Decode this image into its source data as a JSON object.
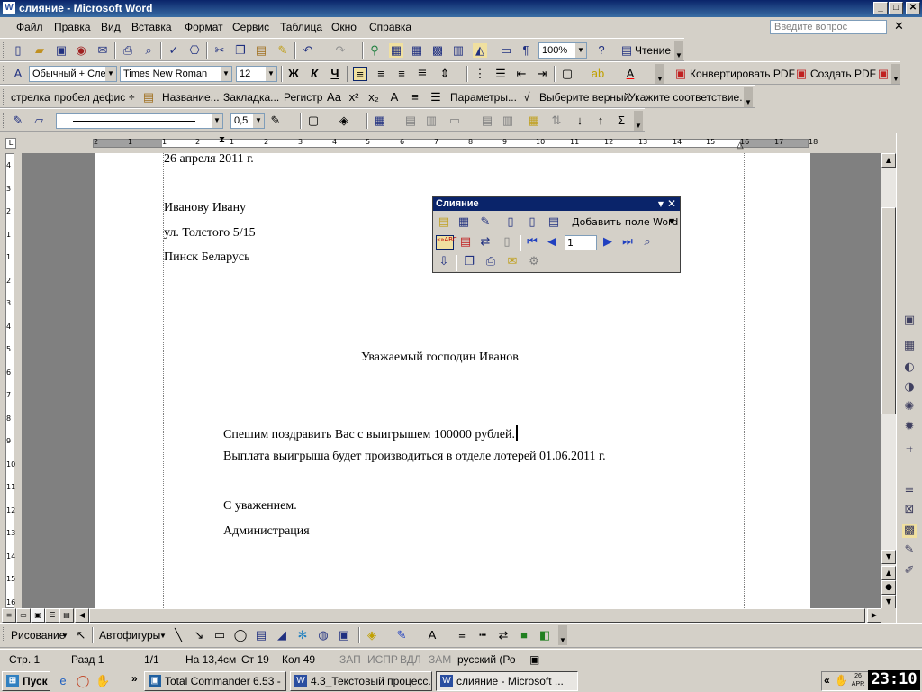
{
  "window": {
    "title": "слияние - Microsoft Word",
    "min": "_",
    "max": "□",
    "close": "✕"
  },
  "menu": {
    "items": [
      "Файл",
      "Правка",
      "Вид",
      "Вставка",
      "Формат",
      "Сервис",
      "Таблица",
      "Окно",
      "Справка"
    ],
    "ask_placeholder": "Введите вопрос",
    "close": "✕"
  },
  "standard_toolbar": {
    "zoom": "100%",
    "read_label": "Чтение",
    "para_mark": "¶"
  },
  "format_toolbar": {
    "style": "Обычный + Сле",
    "font": "Times New Roman",
    "size": "12",
    "bold": "Ж",
    "italic": "К",
    "underline": "Ч",
    "convert_pdf": "Конвертировать PDF",
    "create_pdf": "Создать PDF"
  },
  "macro_toolbar": {
    "items": [
      "стрелка",
      "пробел",
      "дефис",
      "÷",
      "Название...",
      "Закладка...",
      "Регистр"
    ],
    "params": "Параметры...",
    "choose": "Выберите верный",
    "match": "Укажите соответствие."
  },
  "tables_toolbar": {
    "line_weight": "0,5",
    "sigma": "Σ"
  },
  "ruler": {
    "labels": [
      "2",
      "1",
      "1",
      "2",
      "1",
      "2",
      "3",
      "4",
      "5",
      "6",
      "7",
      "8",
      "9",
      "10",
      "11",
      "12",
      "13",
      "14",
      "15",
      "16",
      "17",
      "18"
    ]
  },
  "left_ruler": {
    "labels": [
      "4",
      "3",
      "2",
      "1",
      "1",
      "2",
      "3",
      "4",
      "5",
      "6",
      "7",
      "8",
      "9",
      "10",
      "11",
      "12",
      "13",
      "14",
      "15",
      "16"
    ]
  },
  "document": {
    "date": "26 апреля 2011 г.",
    "recipient_name": "Иванову Ивану",
    "recipient_street": "ул.  Толстого 5/15",
    "recipient_city": "Пинск  Беларусь",
    "greeting": "Уважаемый господин  Иванов",
    "line1": "Спешим поздравить Вас с выигрышем 100000 рублей.",
    "line2": "Выплата выигрыша будет производиться в отделе лотерей 01.06.2011 г.",
    "closing": "С уважением.",
    "signature": "Администрация"
  },
  "mail_merge": {
    "title": "Слияние",
    "add_field": "Добавить поле Word",
    "record": "1",
    "abc_label": "«»ABC"
  },
  "drawing_toolbar": {
    "draw": "Рисование",
    "autoshapes": "Автофигуры"
  },
  "status": {
    "page": "Стр.  1",
    "section": "Разд  1",
    "pages": "1/1",
    "at": "На 13,4см",
    "line": "Ст  19",
    "col": "Кол  49",
    "rec": "ЗАП",
    "trk": "ИСПР",
    "ext": "ВДЛ",
    "ovr": "ЗАМ",
    "lang": "русский (Ро"
  },
  "taskbar": {
    "start": "Пуск",
    "more": "»",
    "tasks": [
      "Total Commander 6.53 - ...",
      "4.3_Текстовый процесс...",
      "слияние - Microsoft ..."
    ],
    "tray_more": "«",
    "clock": "23:10",
    "date_day": "26",
    "date_mon": "APR"
  },
  "colors": {
    "title_bar": "#0a246a",
    "face": "#d4d0c8",
    "page": "#ffffff",
    "doc_bg": "#808080"
  }
}
